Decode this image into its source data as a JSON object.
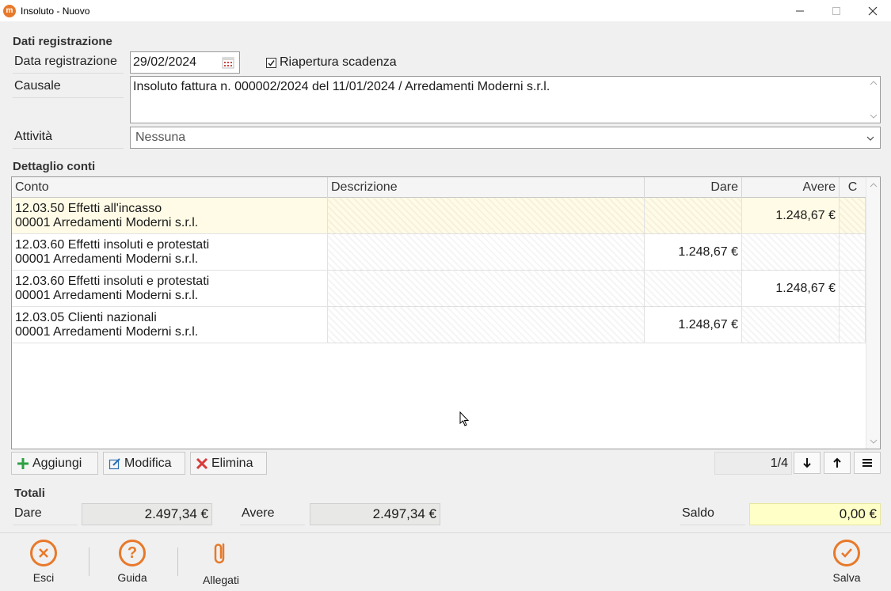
{
  "window": {
    "title": "Insoluto - Nuovo",
    "icon": "app-logo-icon"
  },
  "registrazione": {
    "section_title": "Dati registrazione",
    "data_label": "Data registrazione",
    "data_value": "29/02/2024",
    "riapertura_label": "Riapertura scadenza",
    "riapertura_checked": true,
    "causale_label": "Causale",
    "causale_value": "Insoluto fattura n. 000002/2024 del 11/01/2024 / Arredamenti Moderni s.r.l.",
    "attivita_label": "Attività",
    "attivita_value": "Nessuna"
  },
  "dettaglio": {
    "section_title": "Dettaglio conti",
    "columns": {
      "conto": "Conto",
      "descrizione": "Descrizione",
      "dare": "Dare",
      "avere": "Avere",
      "c": "C"
    },
    "rows": [
      {
        "conto": "12.03.50 Effetti all'incasso",
        "sub": "00001 Arredamenti Moderni s.r.l.",
        "descrizione": "",
        "dare": "",
        "avere": "1.248,67 €"
      },
      {
        "conto": "12.03.60 Effetti insoluti e protestati",
        "sub": "00001 Arredamenti Moderni s.r.l.",
        "descrizione": "",
        "dare": "1.248,67 €",
        "avere": ""
      },
      {
        "conto": "12.03.60 Effetti insoluti e protestati",
        "sub": "00001 Arredamenti Moderni s.r.l.",
        "descrizione": "",
        "dare": "",
        "avere": "1.248,67 €"
      },
      {
        "conto": "12.03.05 Clienti nazionali",
        "sub": "00001 Arredamenti Moderni s.r.l.",
        "descrizione": "",
        "dare": "1.248,67 €",
        "avere": ""
      }
    ]
  },
  "toolbar": {
    "aggiungi": "Aggiungi",
    "modifica": "Modifica",
    "elimina": "Elimina",
    "pager": "1/4"
  },
  "totali": {
    "section_title": "Totali",
    "dare_label": "Dare",
    "dare_value": "2.497,34 €",
    "avere_label": "Avere",
    "avere_value": "2.497,34 €",
    "saldo_label": "Saldo",
    "saldo_value": "0,00 €",
    "saldo_color": "#ffffc8"
  },
  "footer": {
    "esci": "Esci",
    "guida": "Guida",
    "allegati": "Allegati",
    "salva": "Salva"
  },
  "colors": {
    "accent": "#e8792a",
    "add_green": "#2ea043",
    "delete_red": "#d83b3b",
    "edit_blue": "#2a6fb5"
  }
}
